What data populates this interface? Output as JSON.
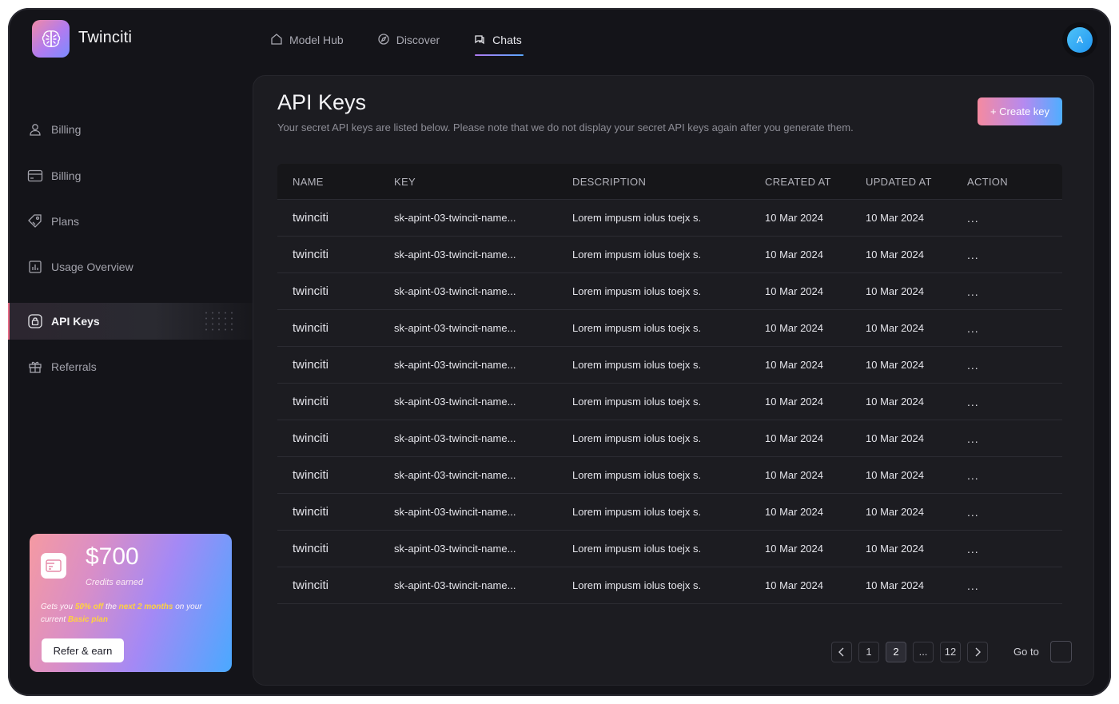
{
  "app": {
    "title": "Twinciti"
  },
  "topnav": [
    {
      "label": "Model Hub",
      "icon": "home-icon",
      "active": false
    },
    {
      "label": "Discover",
      "icon": "compass-icon",
      "active": false
    },
    {
      "label": "Chats",
      "icon": "chat-icon",
      "active": true
    }
  ],
  "user": {
    "avatar_initial": "A"
  },
  "sidebar": {
    "items": [
      {
        "label": "Billing",
        "icon": "user-icon"
      },
      {
        "label": "Billing",
        "icon": "credit-card-icon"
      },
      {
        "label": "Plans",
        "icon": "tag-icon"
      },
      {
        "label": "Usage Overview",
        "icon": "bar-chart-icon"
      },
      {
        "label": "API Keys",
        "icon": "lock-icon",
        "active": true
      },
      {
        "label": "Referrals",
        "icon": "gift-icon"
      }
    ]
  },
  "promo": {
    "amount": "$700",
    "amount_label": "Credits earned",
    "desc_1": "Gets you ",
    "desc_hl_1": "50% off",
    "desc_2": " the ",
    "desc_hl_2": "next 2 months",
    "desc_3": " on your current ",
    "desc_hl_3": "Basic plan",
    "button": "Refer & earn"
  },
  "page": {
    "title": "API Keys",
    "subtitle": "Your secret API keys are listed below. Please note that we do not display your secret API keys again after you generate them.",
    "create_button": "+ Create key"
  },
  "table": {
    "headers": {
      "name": "NAME",
      "key": "KEY",
      "description": "DESCRIPTION",
      "created": "CREATED AT",
      "updated": "UPDATED AT",
      "action": "ACTION"
    },
    "rows": [
      {
        "name": "twinciti",
        "key": "sk-apint-03-twincit-name...",
        "description": "Lorem impusm iolus toejx s.",
        "created": "10 Mar 2024",
        "updated": "10 Mar 2024",
        "action": "..."
      },
      {
        "name": "twinciti",
        "key": "sk-apint-03-twincit-name...",
        "description": "Lorem impusm iolus toejx s.",
        "created": "10 Mar 2024",
        "updated": "10 Mar 2024",
        "action": "..."
      },
      {
        "name": "twinciti",
        "key": "sk-apint-03-twincit-name...",
        "description": "Lorem impusm iolus toejx s.",
        "created": "10 Mar 2024",
        "updated": "10 Mar 2024",
        "action": "..."
      },
      {
        "name": "twinciti",
        "key": "sk-apint-03-twincit-name...",
        "description": "Lorem impusm iolus toejx s.",
        "created": "10 Mar 2024",
        "updated": "10 Mar 2024",
        "action": "..."
      },
      {
        "name": "twinciti",
        "key": "sk-apint-03-twincit-name...",
        "description": "Lorem impusm iolus toejx s.",
        "created": "10 Mar 2024",
        "updated": "10 Mar 2024",
        "action": "..."
      },
      {
        "name": "twinciti",
        "key": "sk-apint-03-twincit-name...",
        "description": "Lorem impusm iolus toejx s.",
        "created": "10 Mar 2024",
        "updated": "10 Mar 2024",
        "action": "..."
      },
      {
        "name": "twinciti",
        "key": "sk-apint-03-twincit-name...",
        "description": "Lorem impusm iolus toejx s.",
        "created": "10 Mar 2024",
        "updated": "10 Mar 2024",
        "action": "..."
      },
      {
        "name": "twinciti",
        "key": "sk-apint-03-twincit-name...",
        "description": "Lorem impusm iolus toejx s.",
        "created": "10 Mar 2024",
        "updated": "10 Mar 2024",
        "action": "..."
      },
      {
        "name": "twinciti",
        "key": "sk-apint-03-twincit-name...",
        "description": "Lorem impusm iolus toejx s.",
        "created": "10 Mar 2024",
        "updated": "10 Mar 2024",
        "action": "..."
      },
      {
        "name": "twinciti",
        "key": "sk-apint-03-twincit-name...",
        "description": "Lorem impusm iolus toejx s.",
        "created": "10 Mar 2024",
        "updated": "10 Mar 2024",
        "action": "..."
      },
      {
        "name": "twinciti",
        "key": "sk-apint-03-twincit-name...",
        "description": "Lorem impusm iolus toejx s.",
        "created": "10 Mar 2024",
        "updated": "10 Mar 2024",
        "action": "..."
      }
    ]
  },
  "pagination": {
    "pages": [
      "1",
      "2",
      "...",
      "12"
    ],
    "current": "2",
    "goto_label": "Go to"
  },
  "colors": {
    "background": "#141419",
    "panel": "#1c1c21",
    "accent_pink": "#f58aa0",
    "accent_purple": "#b07bf0",
    "accent_blue": "#4faeff",
    "highlight_yellow": "#ffd23f"
  }
}
